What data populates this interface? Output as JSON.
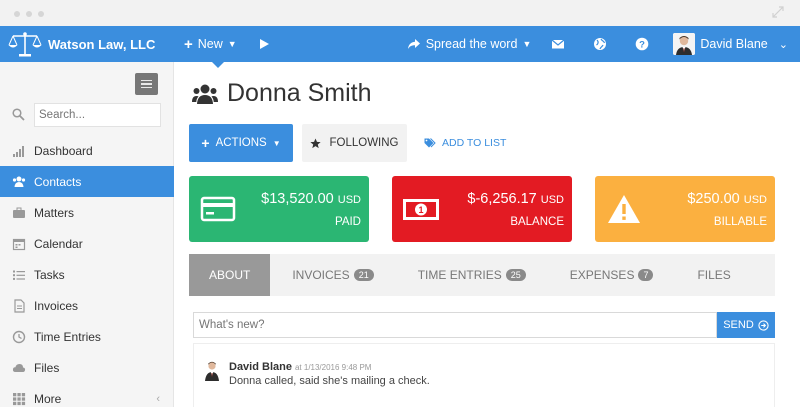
{
  "app": {
    "brand": "Watson Law, LLC"
  },
  "topbar": {
    "new_label": "New",
    "spread_label": "Spread the word",
    "user_name": "David Blane"
  },
  "sidebar": {
    "search_placeholder": "Search...",
    "items": [
      {
        "label": "Dashboard",
        "icon": "bar-chart-icon"
      },
      {
        "label": "Contacts",
        "icon": "users-icon",
        "active": true
      },
      {
        "label": "Matters",
        "icon": "briefcase-icon"
      },
      {
        "label": "Calendar",
        "icon": "calendar-icon"
      },
      {
        "label": "Tasks",
        "icon": "list-icon"
      },
      {
        "label": "Invoices",
        "icon": "document-icon"
      },
      {
        "label": "Time Entries",
        "icon": "clock-icon"
      },
      {
        "label": "Files",
        "icon": "cloud-icon"
      },
      {
        "label": "More",
        "icon": "grid-icon"
      }
    ]
  },
  "page": {
    "title": "Donna Smith"
  },
  "actions": {
    "actions_label": "ACTIONS",
    "following_label": "FOLLOWING",
    "add_list_label": "ADD TO LIST"
  },
  "stats": {
    "paid": {
      "amount": "$13,520.00",
      "currency": "USD",
      "label": "PAID",
      "color": "#2bb673"
    },
    "balance": {
      "amount": "$-6,256.17",
      "currency": "USD",
      "label": "BALANCE",
      "color": "#e31b23"
    },
    "billable": {
      "amount": "$250.00",
      "currency": "USD",
      "label": "BILLABLE",
      "color": "#fbb040"
    }
  },
  "tabs": [
    {
      "label": "ABOUT",
      "active": true
    },
    {
      "label": "INVOICES",
      "count": "21"
    },
    {
      "label": "TIME ENTRIES",
      "count": "25"
    },
    {
      "label": "EXPENSES",
      "count": "7"
    },
    {
      "label": "FILES"
    }
  ],
  "post": {
    "placeholder": "What's new?",
    "send_label": "SEND"
  },
  "feed": [
    {
      "author": "David Blane",
      "time": "at 1/13/2016 9:48 PM",
      "text": "Donna called, said she's mailing a check."
    }
  ],
  "colors": {
    "accent": "#3b8ede"
  }
}
